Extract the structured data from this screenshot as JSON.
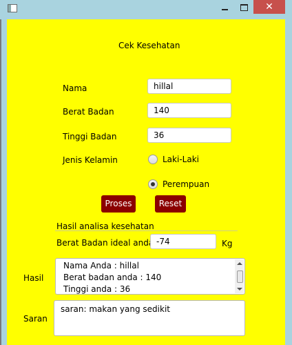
{
  "window": {
    "minimize_label": "",
    "maximize_label": "",
    "close_label": "✕"
  },
  "form": {
    "title": "Cek Kesehatan",
    "name_label": "Nama",
    "name_value": "hillal",
    "weight_label": "Berat Badan",
    "weight_value": "140",
    "height_label": "Tinggi Badan",
    "height_value": "36",
    "gender_label": "Jenis Kelamin",
    "gender_options": [
      "Laki-Laki",
      "Perempuan"
    ],
    "gender_selected": "Perempuan",
    "process_button": "Proses",
    "reset_button": "Reset"
  },
  "result": {
    "section_title": "Hasil analisa kesehatan",
    "ideal_label": "Berat Badan ideal anda",
    "ideal_value": "-74",
    "ideal_unit": "Kg",
    "hasil_label": "Hasil",
    "hasil_lines": [
      "Nama Anda : hillal",
      "Berat badan anda : 140",
      "Tinggi anda : 36"
    ],
    "saran_label": "Saran",
    "saran_text": "saran: makan yang sedikit"
  }
}
